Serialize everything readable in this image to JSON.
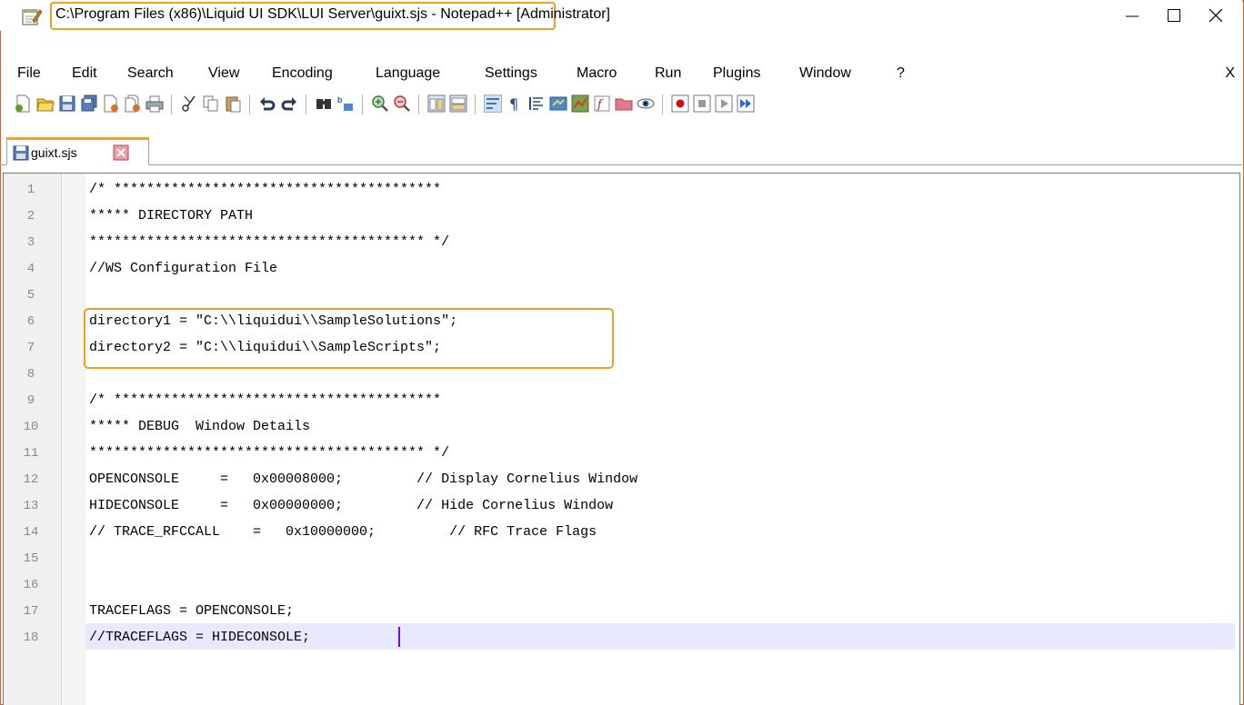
{
  "window": {
    "title": "C:\\Program Files (x86)\\Liquid UI SDK\\LUI Server\\guixt.sjs - Notepad++ [Administrator]"
  },
  "window_controls": {
    "minimize": "—",
    "maximize": "☐",
    "close": "✕"
  },
  "menubar": {
    "items": [
      {
        "label": "File"
      },
      {
        "label": "Edit"
      },
      {
        "label": "Search"
      },
      {
        "label": "View"
      },
      {
        "label": "Encoding"
      },
      {
        "label": "Language"
      },
      {
        "label": "Settings"
      },
      {
        "label": "Macro"
      },
      {
        "label": "Run"
      },
      {
        "label": "Plugins"
      },
      {
        "label": "Window"
      },
      {
        "label": "?"
      }
    ],
    "close_label": "X"
  },
  "toolbar": {
    "icons": [
      "new-file-icon",
      "open-file-icon",
      "save-icon",
      "save-all-icon",
      "close-icon",
      "close-all-icon",
      "print-icon",
      "cut-icon",
      "copy-icon",
      "paste-icon",
      "undo-icon",
      "redo-icon",
      "find-icon",
      "replace-icon",
      "zoom-in-icon",
      "zoom-out-icon",
      "sync-vertical-icon",
      "sync-horizontal-icon",
      "word-wrap-icon",
      "show-all-chars-icon",
      "indent-guide-icon",
      "udl-icon",
      "doc-map-icon",
      "function-list-icon",
      "folder-workspace-icon",
      "monitoring-icon",
      "record-macro-icon",
      "stop-macro-icon",
      "play-macro-icon",
      "run-macro-multiple-icon"
    ]
  },
  "tab": {
    "label": "guixt.sjs"
  },
  "editor": {
    "lines": [
      {
        "num": "1",
        "text": "/* ****************************************"
      },
      {
        "num": "2",
        "text": "***** DIRECTORY PATH"
      },
      {
        "num": "3",
        "text": "***************************************** */"
      },
      {
        "num": "4",
        "text": "//WS Configuration File"
      },
      {
        "num": "5",
        "text": ""
      },
      {
        "num": "6",
        "text": "directory1 = \"C:\\\\liquidui\\\\SampleSolutions\";"
      },
      {
        "num": "7",
        "text": "directory2 = \"C:\\\\liquidui\\\\SampleScripts\";"
      },
      {
        "num": "8",
        "text": ""
      },
      {
        "num": "9",
        "text": "/* ****************************************"
      },
      {
        "num": "10",
        "text": "***** DEBUG  Window Details"
      },
      {
        "num": "11",
        "text": "***************************************** */"
      },
      {
        "num": "12",
        "text": "OPENCONSOLE     =   0x00008000;         // Display Cornelius Window"
      },
      {
        "num": "13",
        "text": "HIDECONSOLE     =   0x00000000;         // Hide Cornelius Window"
      },
      {
        "num": "14",
        "text": "// TRACE_RFCCALL    =   0x10000000;         // RFC Trace Flags"
      },
      {
        "num": "15",
        "text": ""
      },
      {
        "num": "16",
        "text": ""
      },
      {
        "num": "17",
        "text": "TRACEFLAGS = OPENCONSOLE;"
      },
      {
        "num": "18",
        "text": "//TRACEFLAGS = HIDECONSOLE;"
      }
    ]
  },
  "colors": {
    "highlight": "#f0a020",
    "current_line": "#e8e8ff",
    "caret": "#8000ff",
    "line_numbers": "#8a8a8a"
  }
}
